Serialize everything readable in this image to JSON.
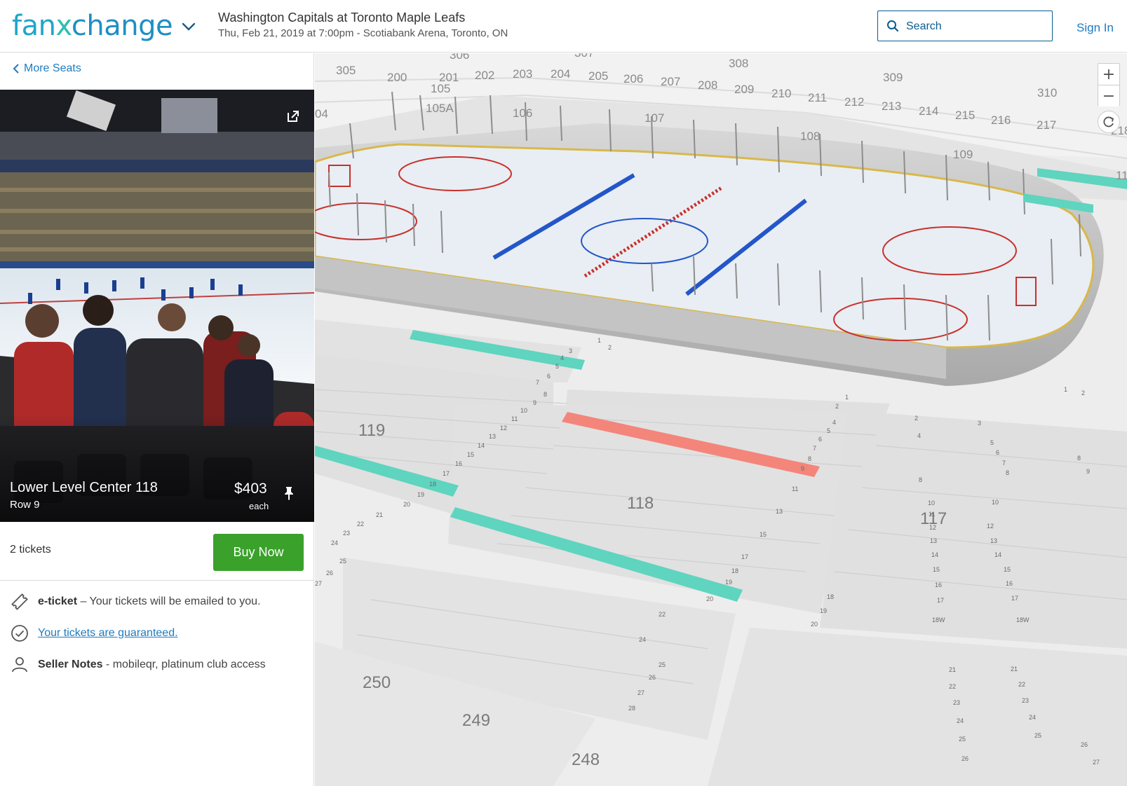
{
  "brand": {
    "logo_fan": "fan",
    "logo_x": "x",
    "logo_change": "change"
  },
  "event": {
    "title": "Washington Capitals at Toronto Maple Leafs",
    "subtitle": "Thu, Feb 21, 2019 at 7:00pm - Scotiabank Arena, Toronto, ON"
  },
  "search": {
    "placeholder": "Search",
    "value": ""
  },
  "header": {
    "signin_label": "Sign In"
  },
  "listing": {
    "back_label": "More Seats",
    "section": "Lower Level Center 118",
    "row": "Row 9",
    "price": "$403",
    "price_unit": "each",
    "quantity": "2 tickets",
    "buy_label": "Buy Now",
    "info": {
      "eticket_label": "e-ticket",
      "eticket_text": " – Your tickets will be emailed to you.",
      "guarantee_link": "Your tickets are guaranteed.",
      "seller_label": "Seller Notes",
      "seller_text": " - mobileqr, platinum club access"
    }
  },
  "map": {
    "zoom_in": "+",
    "zoom_out": "−",
    "colors": {
      "available": "#5fd4bf",
      "selected": "#f4857a",
      "rink_line_blue": "#2456c9",
      "rink_line_red": "#c9302c"
    },
    "upper_sections": [
      "306",
      "307",
      "308",
      "309",
      "310",
      "305",
      "200",
      "201",
      "202",
      "203",
      "204",
      "205",
      "206",
      "207",
      "208",
      "209",
      "210",
      "211",
      "212",
      "213",
      "214",
      "215",
      "216",
      "217",
      "218"
    ],
    "club_sections": [
      "105",
      "105A",
      "106",
      "107",
      "108",
      "109",
      "04",
      "11"
    ],
    "lower_sections": [
      "119",
      "118",
      "117",
      "250",
      "249",
      "248"
    ],
    "row_numbers_118": [
      "1",
      "2",
      "3",
      "4",
      "5",
      "6",
      "7",
      "8",
      "9",
      "11",
      "13",
      "15",
      "17",
      "18",
      "19",
      "20",
      "22",
      "24",
      "25",
      "26",
      "27",
      "28"
    ],
    "row_numbers_119": [
      "1",
      "2",
      "3",
      "4",
      "5",
      "6",
      "7",
      "8",
      "9",
      "10",
      "11",
      "12",
      "13",
      "14",
      "15",
      "16",
      "17",
      "18",
      "19",
      "20",
      "21",
      "22",
      "23",
      "24",
      "25",
      "26",
      "27"
    ],
    "row_numbers_117": [
      "2",
      "3",
      "4",
      "5",
      "6",
      "7",
      "8",
      "10",
      "11",
      "12",
      "13",
      "14",
      "15",
      "16",
      "17",
      "18",
      "19",
      "20",
      "21",
      "22",
      "23",
      "24",
      "25",
      "26",
      "18W"
    ]
  }
}
